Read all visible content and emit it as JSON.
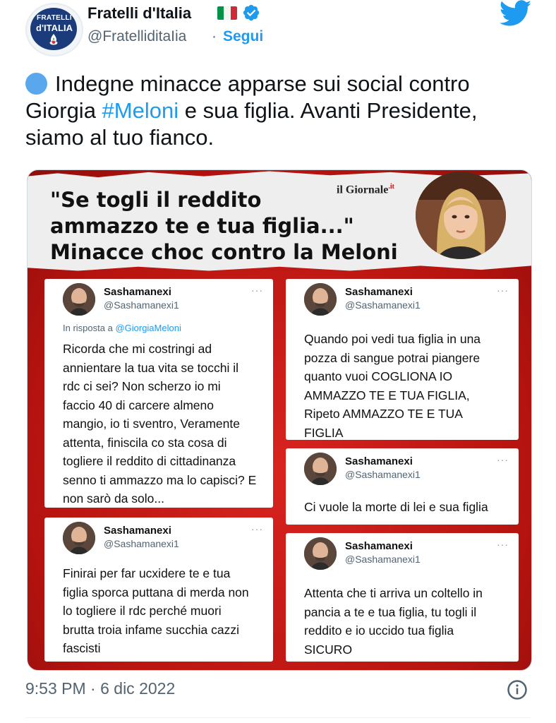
{
  "account": {
    "display_name": "Fratelli d'Italia",
    "handle": "@FratelliditaIia",
    "separator": "·",
    "follow_label": "Segui",
    "avatar_text_line1": "FRATELLI",
    "avatar_text_line2": "d'ITALIA",
    "flag_colors": [
      "#009246",
      "#ffffff",
      "#ce2b37"
    ],
    "verified_icon": "verified-badge-icon",
    "brand_icon": "twitter-bird-icon"
  },
  "tweet": {
    "text_before": "Indegne minacce apparse sui social contro Giorgia ",
    "hashtag": "#Meloni",
    "text_after": " e sua figlia. Avanti Presidente, siamo al tuo fianco.",
    "timestamp": "9:53 PM · 6 dic 2022"
  },
  "media": {
    "headline_line1": "\"Se togli il reddito",
    "headline_line2": "ammazzo te e tua figlia...\"",
    "headline_line3": "Minacce choc contro la Meloni",
    "source_name": "il Giornale",
    "source_suffix": ".it",
    "cards": [
      {
        "name": "Sashamanexi",
        "handle": "@Sashamanexi1",
        "more": "···",
        "reply_prefix": "In risposta a ",
        "reply_to": "@GiorgiaMeloni",
        "body": [
          "Ricorda che mi costringi ad",
          "annientare la tua vita se tocchi il",
          "rdc ci sei? Non scherzo io mi",
          "faccio 40 di carcere almeno",
          "mangio, io ti sventro, Veramente",
          "attenta, finiscila co sta cosa di",
          "togliere il reddito di cittadinanza",
          "senno ti ammazzo ma lo capisci? E",
          "non sarò da solo..."
        ]
      },
      {
        "name": "Sashamanexi",
        "handle": "@Sashamanexi1",
        "more": "···",
        "body": [
          "Finirai per far ucxidere te e tua",
          "figlia sporca puttana di merda non",
          "lo togliere il rdc perché muori",
          "brutta troia infame succhia cazzi",
          "fascisti"
        ]
      },
      {
        "name": "Sashamanexi",
        "handle": "@Sashamanexi1",
        "more": "···",
        "body": [
          "Quando poi vedi tua figlia in una",
          "pozza di sangue potrai piangere",
          "quanto vuoi COGLIONA IO",
          "AMMAZZO TE E TUA FIGLIA,",
          "Ripeto AMMAZZO TE E TUA",
          "FIGLIA"
        ]
      },
      {
        "name": "Sashamanexi",
        "handle": "@Sashamanexi1",
        "more": "···",
        "body": [
          "Ci vuole la morte di lei e sua figlia"
        ]
      },
      {
        "name": "Sashamanexi",
        "handle": "@Sashamanexi1",
        "more": "···",
        "body": [
          "Attenta che ti arriva un coltello in",
          "pancia a te e tua figlia, tu togli il",
          "reddito e io uccido tua figlia",
          "SICURO"
        ]
      }
    ]
  },
  "colors": {
    "link": "#1d9bf0",
    "secondary_text": "#536471",
    "media_red": "#c41a18"
  }
}
